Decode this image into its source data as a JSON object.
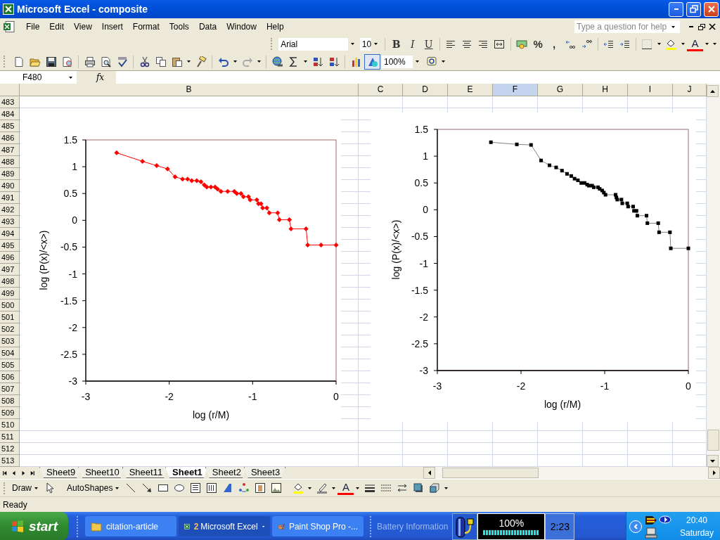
{
  "window": {
    "title": "Microsoft Excel - composite"
  },
  "menu": [
    "File",
    "Edit",
    "View",
    "Insert",
    "Format",
    "Tools",
    "Data",
    "Window",
    "Help"
  ],
  "help_box": {
    "placeholder": "Type a question for help"
  },
  "formatting_toolbar": {
    "font": "Arial",
    "size": "10",
    "style_buttons": [
      "B",
      "I",
      "U"
    ],
    "number_buttons": [
      "%",
      ","
    ],
    "font_color_glyph": "A"
  },
  "standard_toolbar": {
    "zoom": "100%",
    "drawing_on": true
  },
  "formula_bar": {
    "name_box": "F480",
    "function_label": "fx"
  },
  "columns": [
    {
      "label": "B",
      "selected": false
    },
    {
      "label": "C",
      "selected": false
    },
    {
      "label": "D",
      "selected": false
    },
    {
      "label": "E",
      "selected": false
    },
    {
      "label": "F",
      "selected": true
    },
    {
      "label": "G",
      "selected": false
    },
    {
      "label": "H",
      "selected": false
    },
    {
      "label": "I",
      "selected": false
    },
    {
      "label": "J",
      "selected": false
    }
  ],
  "rows": [
    "483",
    "484",
    "485",
    "486",
    "487",
    "488",
    "489",
    "490",
    "491",
    "492",
    "493",
    "494",
    "495",
    "496",
    "497",
    "498",
    "499",
    "500",
    "501",
    "502",
    "503",
    "504",
    "505",
    "506",
    "507",
    "508",
    "509",
    "510",
    "511",
    "512",
    "513"
  ],
  "charts": [
    {
      "chart_data": {
        "type": "line",
        "xlabel": "log (r/M)",
        "ylabel": "log (P(x)/<x>)",
        "xlim": [
          -3,
          0
        ],
        "ylim": [
          -3,
          1.5
        ],
        "xticks": [
          -3,
          -2,
          -1,
          0
        ],
        "yticks": [
          -3,
          -2.5,
          -2,
          -1.5,
          -1,
          -0.5,
          0,
          0.5,
          1,
          1.5
        ],
        "x": [
          -2.63,
          -2.32,
          -2.15,
          -2.02,
          -1.93,
          -1.84,
          -1.78,
          -1.73,
          -1.67,
          -1.62,
          -1.58,
          -1.55,
          -1.5,
          -1.45,
          -1.42,
          -1.38,
          -1.3,
          -1.22,
          -1.19,
          -1.14,
          -1.11,
          -1.05,
          -1.03,
          -0.95,
          -0.93,
          -0.9,
          -0.88,
          -0.83,
          -0.8,
          -0.7,
          -0.68,
          -0.56,
          -0.54,
          -0.36,
          -0.34,
          -0.18,
          0
        ],
        "series": [
          {
            "color": "#ff0000",
            "marker": "diamond",
            "values": [
              1.26,
              1.1,
              1.02,
              0.96,
              0.81,
              0.77,
              0.77,
              0.74,
              0.74,
              0.72,
              0.66,
              0.62,
              0.62,
              0.62,
              0.58,
              0.54,
              0.54,
              0.54,
              0.5,
              0.5,
              0.44,
              0.44,
              0.38,
              0.38,
              0.31,
              0.31,
              0.23,
              0.23,
              0.14,
              0.14,
              0.01,
              0.01,
              -0.16,
              -0.16,
              -0.46,
              -0.46,
              -0.46
            ]
          }
        ]
      }
    },
    {
      "chart_data": {
        "type": "line",
        "xlabel": "log (r/M)",
        "ylabel": "log (P(x)/<x>)",
        "xlim": [
          -3,
          0
        ],
        "ylim": [
          -3,
          1.5
        ],
        "xticks": [
          -3,
          -2,
          -1,
          0
        ],
        "yticks": [
          -3,
          -2.5,
          -2,
          -1.5,
          -1,
          -0.5,
          0,
          0.5,
          1,
          1.5
        ],
        "x": [
          -2.36,
          -2.05,
          -1.88,
          -1.76,
          -1.66,
          -1.58,
          -1.51,
          -1.45,
          -1.4,
          -1.36,
          -1.32,
          -1.28,
          -1.24,
          -1.21,
          -1.19,
          -1.15,
          -1.13,
          -1.08,
          -1.06,
          -1.03,
          -1.01,
          -0.99,
          -0.87,
          -0.86,
          -0.85,
          -0.8,
          -0.79,
          -0.73,
          -0.72,
          -0.66,
          -0.65,
          -0.62,
          -0.61,
          -0.5,
          -0.49,
          -0.36,
          -0.35,
          -0.22,
          -0.21,
          0
        ],
        "series": [
          {
            "color": "#000000",
            "marker": "square",
            "values": [
              1.26,
              1.22,
              1.21,
              0.92,
              0.83,
              0.79,
              0.73,
              0.67,
              0.63,
              0.58,
              0.55,
              0.5,
              0.5,
              0.47,
              0.45,
              0.45,
              0.42,
              0.42,
              0.39,
              0.36,
              0.32,
              0.28,
              0.28,
              0.23,
              0.19,
              0.19,
              0.12,
              0.12,
              0.06,
              0.06,
              -0.02,
              -0.02,
              -0.11,
              -0.11,
              -0.25,
              -0.25,
              -0.42,
              -0.42,
              -0.72,
              -0.72
            ]
          }
        ]
      }
    }
  ],
  "sheet_tabs": [
    {
      "label": "Sheet9",
      "selected": false
    },
    {
      "label": "Sheet10",
      "selected": false
    },
    {
      "label": "Sheet11",
      "selected": false
    },
    {
      "label": "Sheet1",
      "selected": true
    },
    {
      "label": "Sheet2",
      "selected": false
    },
    {
      "label": "Sheet3",
      "selected": false
    }
  ],
  "drawing_toolbar": {
    "draw": "Draw",
    "autoshapes": "AutoShapes",
    "font_color_glyph": "A"
  },
  "status_bar": {
    "text": "Ready"
  },
  "taskbar": {
    "start": "start",
    "buttons": [
      {
        "kind": "folder",
        "label": "citation-article",
        "selected": false
      },
      {
        "kind": "excel",
        "count": "2",
        "label": "Microsoft Excel",
        "selected": true
      },
      {
        "kind": "paint",
        "label": "Paint Shop Pro -...",
        "selected": false
      }
    ],
    "toolbar_label": "Battery Information",
    "battery": {
      "reading": "100%",
      "level": 1,
      "time": "2:23"
    },
    "clock": {
      "time": "20:40",
      "day": "Saturday"
    }
  }
}
